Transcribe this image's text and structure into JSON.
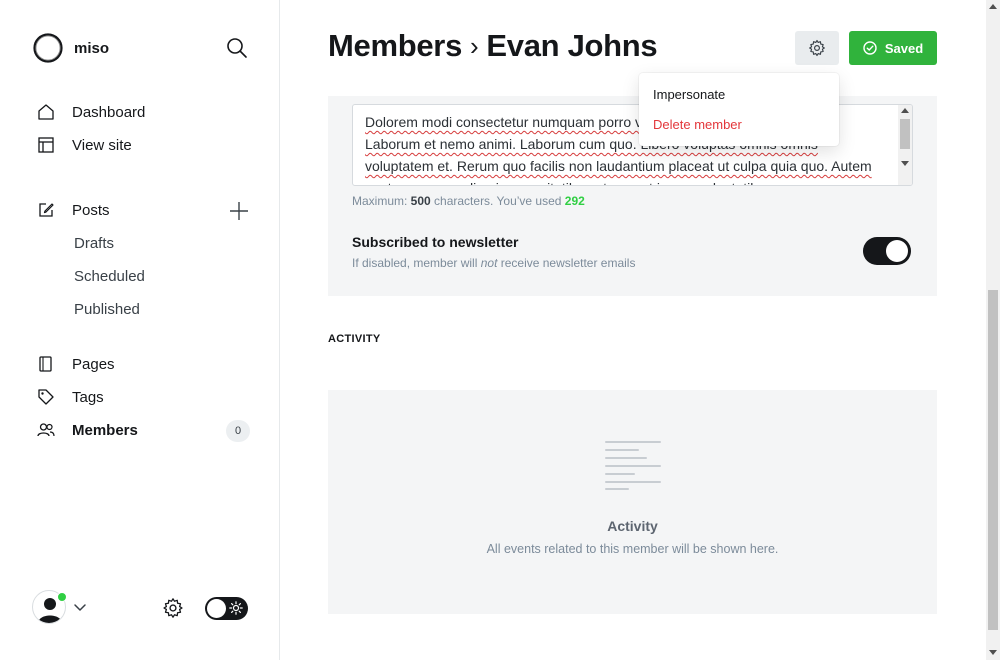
{
  "brand": {
    "name": "miso",
    "logo_icon": "circle-logo-icon"
  },
  "sidebar": {
    "search_icon": "search-icon",
    "items": [
      {
        "label": "Dashboard",
        "icon": "house-icon"
      },
      {
        "label": "View site",
        "icon": "layout-icon"
      },
      {
        "label": "Posts",
        "icon": "edit-icon"
      },
      {
        "label": "Drafts"
      },
      {
        "label": "Scheduled"
      },
      {
        "label": "Published"
      },
      {
        "label": "Pages",
        "icon": "page-icon"
      },
      {
        "label": "Tags",
        "icon": "tag-icon"
      },
      {
        "label": "Members",
        "icon": "members-icon",
        "count": "0"
      }
    ],
    "online_color": "#30cf43"
  },
  "header": {
    "breadcrumb_parent": "Members",
    "separator": "›",
    "member_name": "Evan Johns",
    "saved_label": "Saved",
    "saved_color": "#30b33c"
  },
  "dropdown": {
    "impersonate": "Impersonate",
    "delete": "Delete member",
    "delete_color": "#e3373b"
  },
  "note": {
    "text": "Dolorem modi consectetur numquam porro vero ipsa atque libero inventore. Laborum et nemo animi. Laborum cum quo. Libero voluptas omnis omnis voluptatem et. Rerum quo facilis non laudantium placeat ut culpa quia quo. Autem nostrum commodi qui necessitatibus atque est ipsum voluptatibus.",
    "hint_prefix": "Maximum: ",
    "max": "500",
    "hint_middle": " characters. You’ve used ",
    "used": "292"
  },
  "newsletter": {
    "label": "Subscribed to newsletter",
    "desc_before": "If disabled, member will ",
    "desc_em": "not",
    "desc_after": " receive newsletter emails",
    "enabled": true
  },
  "activity": {
    "section_title": "ACTIVITY",
    "empty_title": "Activity",
    "empty_desc": "All events related to this member will be shown here."
  }
}
